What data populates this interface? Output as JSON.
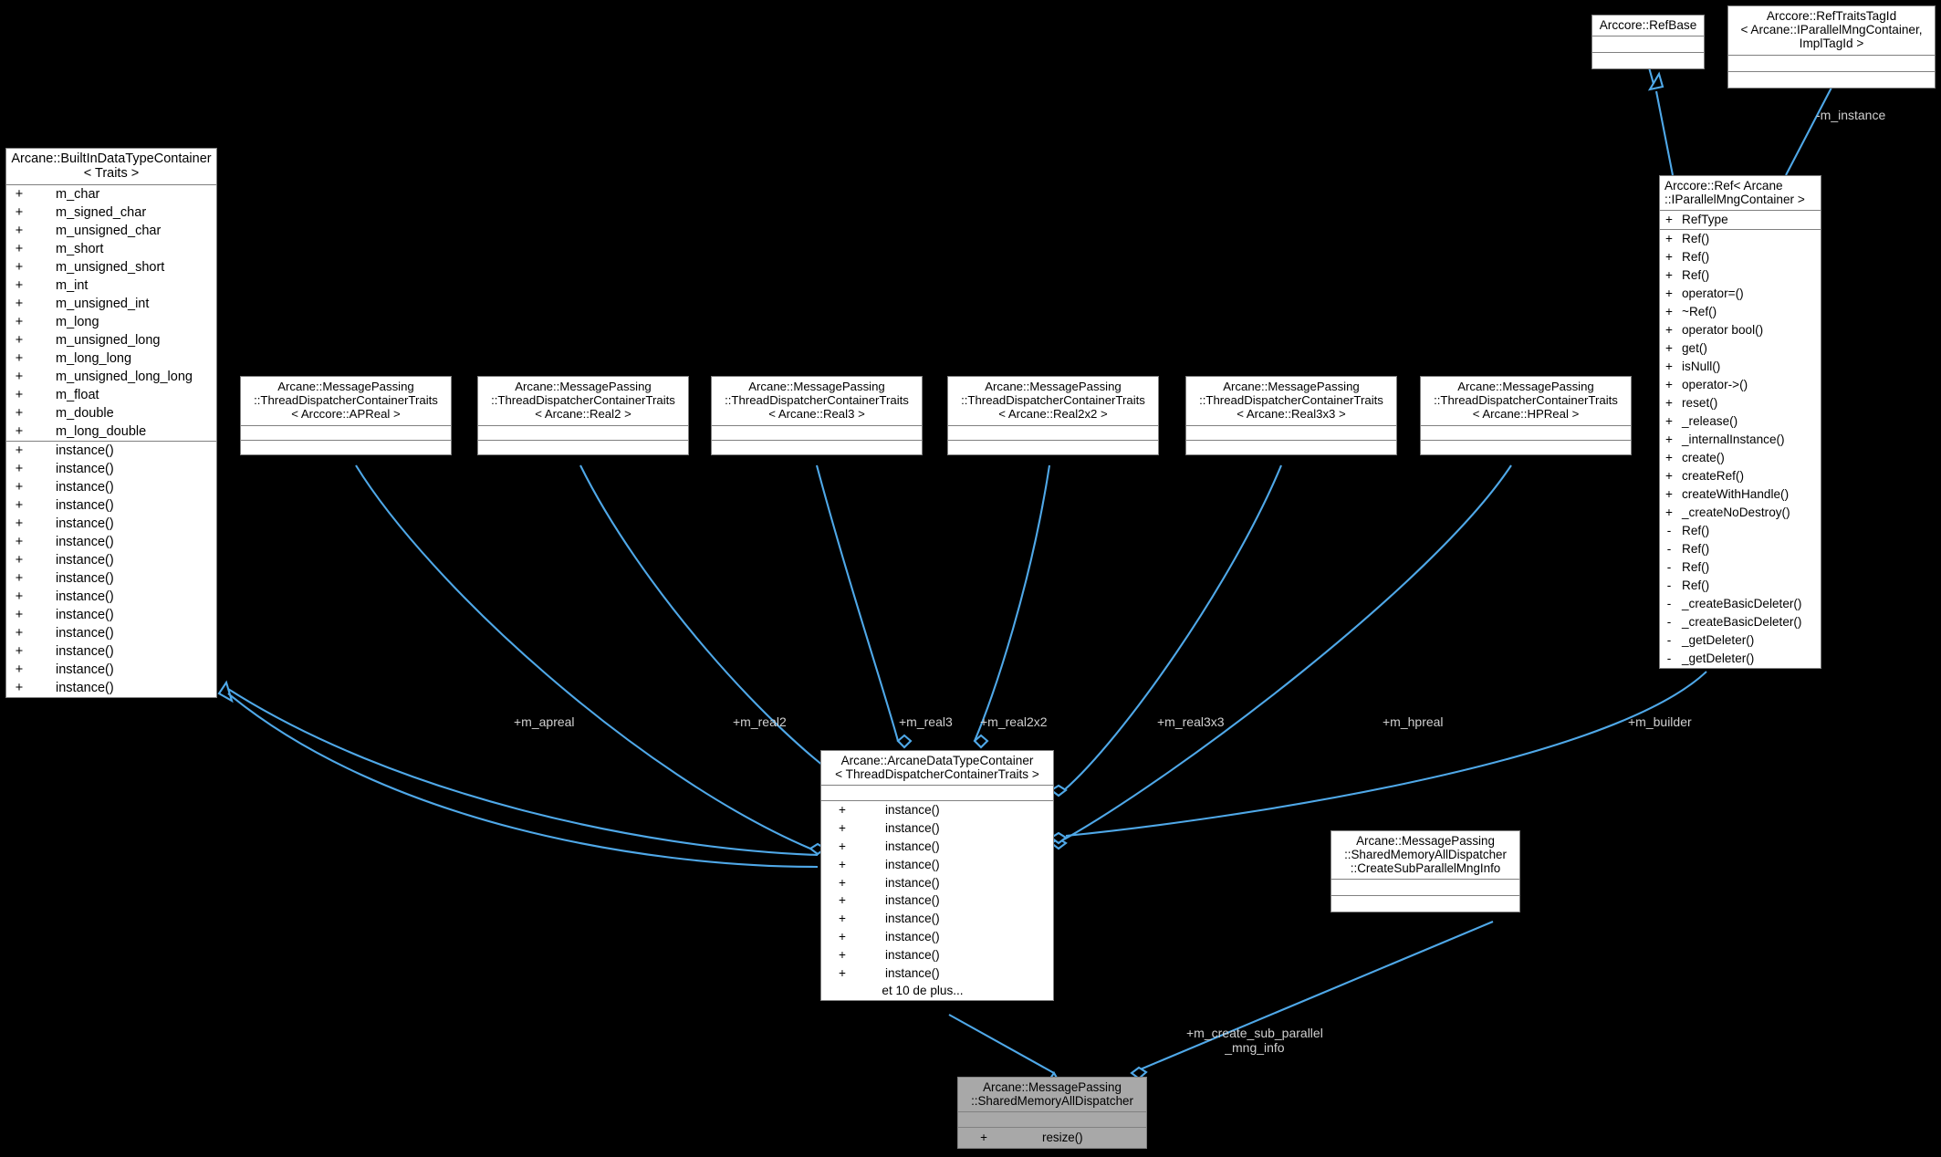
{
  "diagram": {
    "kind": "uml-collaboration-diagram",
    "background": "#000000",
    "edge_color": "#4fa8e8",
    "node_fill": "#ffffff",
    "node_fill_highlight": "#a8a8a8",
    "node_border": "#808080",
    "label_color": "#d0d0d0"
  },
  "nodes": {
    "builtin": {
      "title": "Arcane::BuiltInDataTypeContainer\n< Traits >",
      "attributes": [
        {
          "vis": "+",
          "name": "m_char"
        },
        {
          "vis": "+",
          "name": "m_signed_char"
        },
        {
          "vis": "+",
          "name": "m_unsigned_char"
        },
        {
          "vis": "+",
          "name": "m_short"
        },
        {
          "vis": "+",
          "name": "m_unsigned_short"
        },
        {
          "vis": "+",
          "name": "m_int"
        },
        {
          "vis": "+",
          "name": "m_unsigned_int"
        },
        {
          "vis": "+",
          "name": "m_long"
        },
        {
          "vis": "+",
          "name": "m_unsigned_long"
        },
        {
          "vis": "+",
          "name": "m_long_long"
        },
        {
          "vis": "+",
          "name": "m_unsigned_long_long"
        },
        {
          "vis": "+",
          "name": "m_float"
        },
        {
          "vis": "+",
          "name": "m_double"
        },
        {
          "vis": "+",
          "name": "m_long_double"
        }
      ],
      "methods": [
        {
          "vis": "+",
          "name": "instance()"
        },
        {
          "vis": "+",
          "name": "instance()"
        },
        {
          "vis": "+",
          "name": "instance()"
        },
        {
          "vis": "+",
          "name": "instance()"
        },
        {
          "vis": "+",
          "name": "instance()"
        },
        {
          "vis": "+",
          "name": "instance()"
        },
        {
          "vis": "+",
          "name": "instance()"
        },
        {
          "vis": "+",
          "name": "instance()"
        },
        {
          "vis": "+",
          "name": "instance()"
        },
        {
          "vis": "+",
          "name": "instance()"
        },
        {
          "vis": "+",
          "name": "instance()"
        },
        {
          "vis": "+",
          "name": "instance()"
        },
        {
          "vis": "+",
          "name": "instance()"
        },
        {
          "vis": "+",
          "name": "instance()"
        }
      ]
    },
    "traits_apreal": {
      "title": "Arcane::MessagePassing\n::ThreadDispatcherContainerTraits\n< Arccore::APReal >"
    },
    "traits_real2": {
      "title": "Arcane::MessagePassing\n::ThreadDispatcherContainerTraits\n< Arcane::Real2 >"
    },
    "traits_real3": {
      "title": "Arcane::MessagePassing\n::ThreadDispatcherContainerTraits\n< Arcane::Real3 >"
    },
    "traits_real2x2": {
      "title": "Arcane::MessagePassing\n::ThreadDispatcherContainerTraits\n< Arcane::Real2x2 >"
    },
    "traits_real3x3": {
      "title": "Arcane::MessagePassing\n::ThreadDispatcherContainerTraits\n< Arcane::Real3x3 >"
    },
    "traits_hpreal": {
      "title": "Arcane::MessagePassing\n::ThreadDispatcherContainerTraits\n< Arcane::HPReal >"
    },
    "adtc": {
      "title": "Arcane::ArcaneDataTypeContainer\n< ThreadDispatcherContainerTraits >",
      "methods": [
        {
          "vis": "+",
          "name": "instance()"
        },
        {
          "vis": "+",
          "name": "instance()"
        },
        {
          "vis": "+",
          "name": "instance()"
        },
        {
          "vis": "+",
          "name": "instance()"
        },
        {
          "vis": "+",
          "name": "instance()"
        },
        {
          "vis": "+",
          "name": "instance()"
        },
        {
          "vis": "+",
          "name": "instance()"
        },
        {
          "vis": "+",
          "name": "instance()"
        },
        {
          "vis": "+",
          "name": "instance()"
        },
        {
          "vis": "+",
          "name": "instance()"
        }
      ],
      "more": "et 10 de plus..."
    },
    "refbase": {
      "title": "Arccore::RefBase"
    },
    "reftraits": {
      "title": "Arccore::RefTraitsTagId\n< Arcane::IParallelMngContainer,\nImplTagId >"
    },
    "ref": {
      "title": "Arccore::Ref< Arcane\n::IParallelMngContainer >",
      "attributes": [
        {
          "vis": "+",
          "name": "RefType"
        }
      ],
      "methods": [
        {
          "vis": "+",
          "name": "Ref()"
        },
        {
          "vis": "+",
          "name": "Ref()"
        },
        {
          "vis": "+",
          "name": "Ref()"
        },
        {
          "vis": "+",
          "name": "operator=()"
        },
        {
          "vis": "+",
          "name": "~Ref()"
        },
        {
          "vis": "+",
          "name": "operator bool()"
        },
        {
          "vis": "+",
          "name": "get()"
        },
        {
          "vis": "+",
          "name": "isNull()"
        },
        {
          "vis": "+",
          "name": "operator->()"
        },
        {
          "vis": "+",
          "name": "reset()"
        },
        {
          "vis": "+",
          "name": "_release()"
        },
        {
          "vis": "+",
          "name": "_internalInstance()"
        },
        {
          "vis": "+",
          "name": "create()"
        },
        {
          "vis": "+",
          "name": "createRef()"
        },
        {
          "vis": "+",
          "name": "createWithHandle()"
        },
        {
          "vis": "+",
          "name": "_createNoDestroy()"
        },
        {
          "vis": "-",
          "name": "Ref()"
        },
        {
          "vis": "-",
          "name": "Ref()"
        },
        {
          "vis": "-",
          "name": "Ref()"
        },
        {
          "vis": "-",
          "name": "Ref()"
        },
        {
          "vis": "-",
          "name": "_createBasicDeleter()"
        },
        {
          "vis": "-",
          "name": "_createBasicDeleter()"
        },
        {
          "vis": "-",
          "name": "_getDeleter()"
        },
        {
          "vis": "-",
          "name": "_getDeleter()"
        }
      ]
    },
    "create_sub_info": {
      "title": "Arcane::MessagePassing\n::SharedMemoryAllDispatcher\n::CreateSubParallelMngInfo"
    },
    "shared_mem_all_dispatcher": {
      "title": "Arcane::MessagePassing\n::SharedMemoryAllDispatcher",
      "methods": [
        {
          "vis": "+",
          "name": "resize()"
        }
      ]
    }
  },
  "edges": [
    {
      "label": "+m_apreal",
      "from": "traits_apreal",
      "to": "adtc"
    },
    {
      "label": "+m_real2",
      "from": "traits_real2",
      "to": "adtc"
    },
    {
      "label": "+m_real3",
      "from": "traits_real3",
      "to": "adtc"
    },
    {
      "label": "+m_real2x2",
      "from": "traits_real2x2",
      "to": "adtc"
    },
    {
      "label": "+m_real3x3",
      "from": "traits_real3x3",
      "to": "adtc"
    },
    {
      "label": "+m_hpreal",
      "from": "traits_hpreal",
      "to": "adtc"
    },
    {
      "label": "+m_builder",
      "from": "ref",
      "to": "adtc"
    },
    {
      "label": "-m_instance",
      "from": "reftraits",
      "to": "ref"
    },
    {
      "label": "+m_create_sub_parallel\n_mng_info",
      "from": "create_sub_info",
      "to": "shared_mem_all_dispatcher"
    }
  ],
  "edge_labels": {
    "m_apreal": "+m_apreal",
    "m_real2": "+m_real2",
    "m_real3": "+m_real3",
    "m_real2x2": "+m_real2x2",
    "m_real3x3": "+m_real3x3",
    "m_hpreal": "+m_hpreal",
    "m_builder": "+m_builder",
    "m_instance": "-m_instance",
    "m_create_sub_parallel_mng_info": "+m_create_sub_parallel\n_mng_info"
  }
}
